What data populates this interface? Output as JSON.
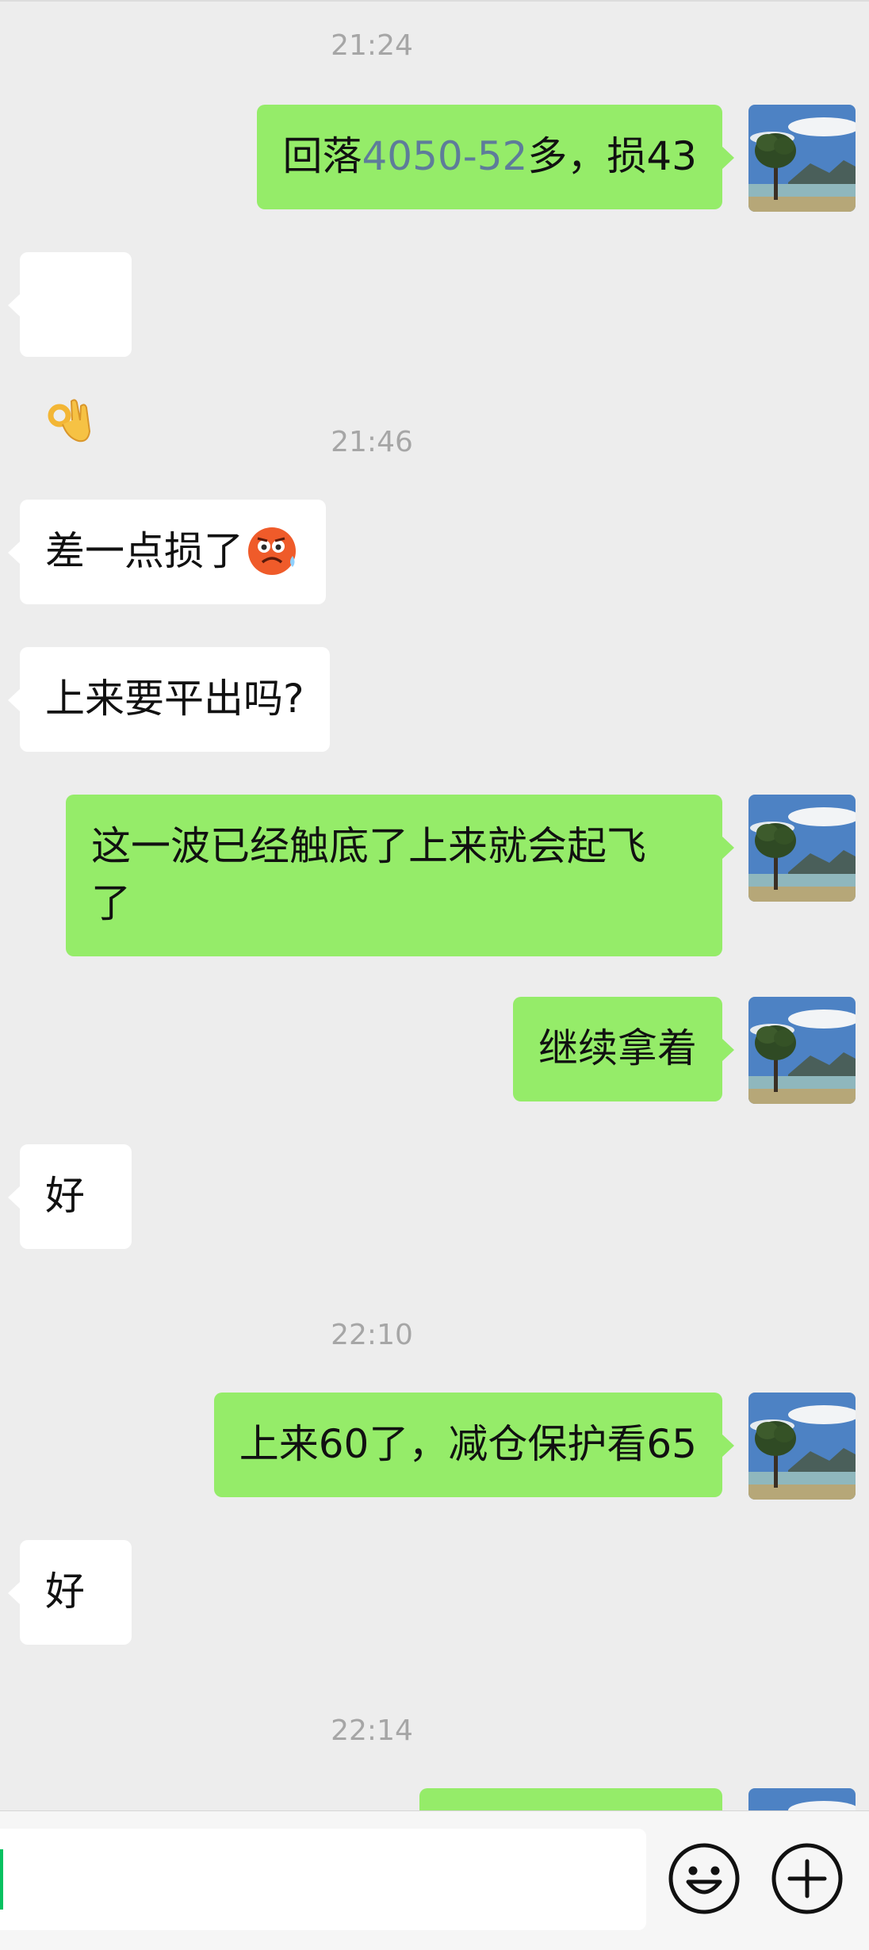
{
  "messages": {
    "t1": "21:24",
    "m1_pre": "回落",
    "m1_hl": "4050-52",
    "m1_post": "多，损43",
    "r1_emoji": "ok-hand-emoji",
    "t2": "21:46",
    "r2_text": "差一点损了",
    "r2_emoji": "frowning-sweat-emoji",
    "r3": "上来要平出吗?",
    "m2": "这一波已经触底了上来就会起飞\n了",
    "m3": "继续拿着",
    "r4": "好",
    "t3": "22:10",
    "m4": "上来60了，减仓保护看65",
    "r5": "好",
    "t4": "22:14"
  },
  "input": {
    "value": "",
    "emoji_button_icon": "smiley-icon",
    "more_button_icon": "plus-circle-icon"
  },
  "colors": {
    "background": "#ededed",
    "my_bubble": "#95ec69",
    "their_bubble": "#ffffff",
    "highlight_text": "#5e7c9a",
    "timestamp": "#a6a6a6",
    "caret": "#07c160"
  }
}
